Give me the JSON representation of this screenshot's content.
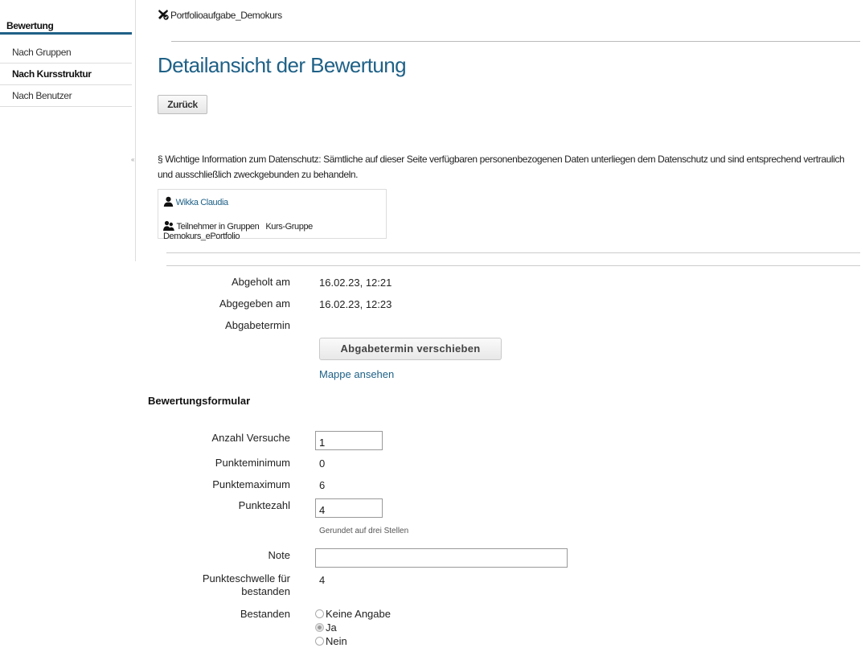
{
  "sidebar": {
    "heading": "Bewertung",
    "items": [
      {
        "label": "Nach Gruppen",
        "active": false
      },
      {
        "label": "Nach Kursstruktur",
        "active": true
      },
      {
        "label": "Nach Benutzer",
        "active": false
      }
    ],
    "collapse_glyph": "«"
  },
  "breadcrumb": {
    "label": "Portfolioaufgabe_Demokurs",
    "icon": "portfolio-task-icon"
  },
  "page": {
    "title": "Detailansicht der Bewertung",
    "back_label": "Zurück"
  },
  "privacy_notice": "§ Wichtige Information zum Datenschutz: Sämtliche auf dieser Seite verfügbaren personenbezogenen Daten unterliegen dem Datenschutz und sind entsprechend vertraulich und ausschließlich zweckgebunden zu behandeln.",
  "participant": {
    "name": "Wikka Claudia",
    "group_label": "Teilnehmer in Gruppen",
    "group_value": "Kurs-Gruppe Demokurs_ePortfolio"
  },
  "submission": {
    "picked_up_label": "Abgeholt am",
    "picked_up_value": "16.02.23, 12:21",
    "submitted_label": "Abgegeben am",
    "submitted_value": "16.02.23, 12:23",
    "deadline_label": "Abgabetermin",
    "defer_button": "Abgabetermin verschieben",
    "view_link": "Mappe ansehen"
  },
  "form": {
    "section_title": "Bewertungsformular",
    "attempts_label": "Anzahl Versuche",
    "attempts_value": "1",
    "min_label": "Punkteminimum",
    "min_value": "0",
    "max_label": "Punktemaximum",
    "max_value": "6",
    "score_label": "Punktezahl",
    "score_value": "4",
    "score_hint": "Gerundet auf drei Stellen",
    "grade_label": "Note",
    "grade_value": "",
    "threshold_label_1": "Punkteschwelle für",
    "threshold_label_2": "bestanden",
    "threshold_value": "4",
    "passed_label": "Bestanden",
    "passed_options": [
      {
        "label": "Keine Angabe",
        "selected": false
      },
      {
        "label": "Ja",
        "selected": true
      },
      {
        "label": "Nein",
        "selected": false
      }
    ]
  },
  "colors": {
    "accent": "#1f6187"
  }
}
